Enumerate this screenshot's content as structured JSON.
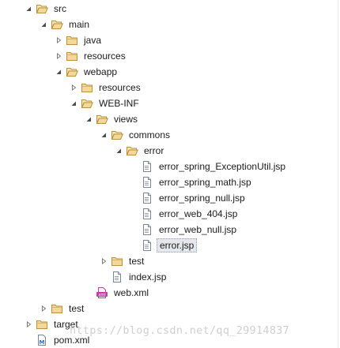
{
  "tree": {
    "items": [
      {
        "label": "src",
        "level": 0,
        "expanded": true,
        "icon": "folder-open-icon"
      },
      {
        "label": "main",
        "level": 1,
        "expanded": true,
        "icon": "folder-open-icon"
      },
      {
        "label": "java",
        "level": 2,
        "expanded": false,
        "icon": "folder-icon"
      },
      {
        "label": "resources",
        "level": 2,
        "expanded": false,
        "icon": "folder-icon"
      },
      {
        "label": "webapp",
        "level": 2,
        "expanded": true,
        "icon": "folder-open-icon"
      },
      {
        "label": "resources",
        "level": 3,
        "expanded": false,
        "icon": "folder-icon"
      },
      {
        "label": "WEB-INF",
        "level": 3,
        "expanded": true,
        "icon": "folder-open-icon"
      },
      {
        "label": "views",
        "level": 4,
        "expanded": true,
        "icon": "folder-open-icon"
      },
      {
        "label": "commons",
        "level": 5,
        "expanded": true,
        "icon": "folder-open-icon"
      },
      {
        "label": "error",
        "level": 6,
        "expanded": true,
        "icon": "folder-open-icon"
      },
      {
        "label": "error_spring_ExceptionUtil.jsp",
        "level": 7,
        "expanded": null,
        "icon": "jsp-file-icon"
      },
      {
        "label": "error_spring_math.jsp",
        "level": 7,
        "expanded": null,
        "icon": "jsp-file-icon"
      },
      {
        "label": "error_spring_null.jsp",
        "level": 7,
        "expanded": null,
        "icon": "jsp-file-icon"
      },
      {
        "label": "error_web_404.jsp",
        "level": 7,
        "expanded": null,
        "icon": "jsp-file-icon"
      },
      {
        "label": "error_web_null.jsp",
        "level": 7,
        "expanded": null,
        "icon": "jsp-file-icon"
      },
      {
        "label": "error.jsp",
        "level": 7,
        "expanded": null,
        "icon": "jsp-file-icon",
        "selected": true
      },
      {
        "label": "test",
        "level": 5,
        "expanded": false,
        "icon": "folder-icon"
      },
      {
        "label": "index.jsp",
        "level": 5,
        "expanded": null,
        "icon": "jsp-file-icon"
      },
      {
        "label": "web.xml",
        "level": 4,
        "expanded": null,
        "icon": "xml-file-icon"
      },
      {
        "label": "test",
        "level": 1,
        "expanded": false,
        "icon": "folder-icon"
      },
      {
        "label": "target",
        "level": 0,
        "expanded": false,
        "icon": "folder-icon"
      },
      {
        "label": "pom.xml",
        "level": 0,
        "expanded": null,
        "icon": "maven-pom-icon"
      }
    ]
  },
  "watermark": "https://blog.csdn.net/qq_29914837",
  "colors": {
    "folder": "#f2d99a",
    "folder_stroke": "#b8913a",
    "selection": "#e4e7ec",
    "xml": "#c43aa8",
    "pom": "#2f6fb3"
  }
}
